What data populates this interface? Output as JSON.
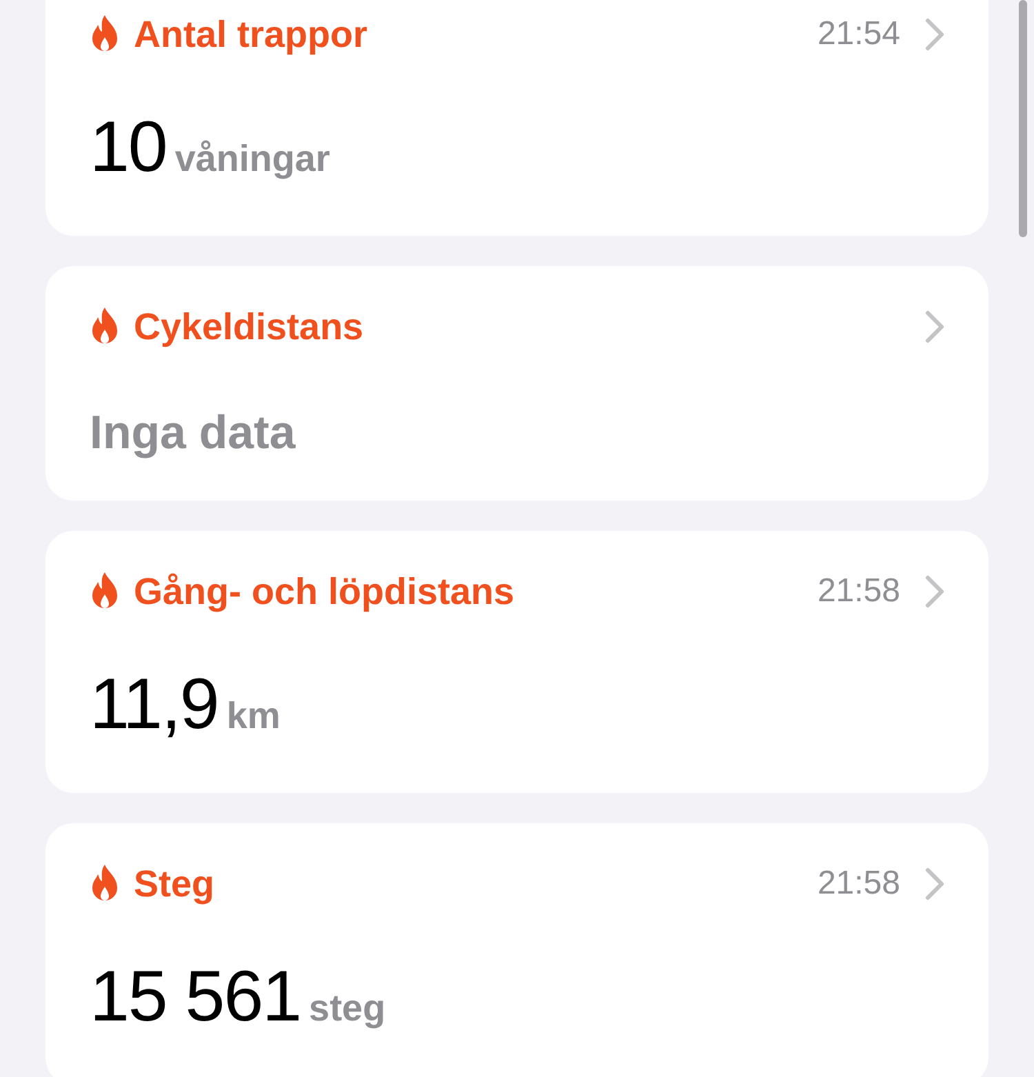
{
  "cards": [
    {
      "kind": "value",
      "title": "Antal trappor",
      "time": "21:54",
      "value": "10",
      "unit": "våningar"
    },
    {
      "kind": "empty",
      "title": "Cykeldistans",
      "value": "Inga data"
    },
    {
      "kind": "value",
      "title": "Gång- och löpdistans",
      "time": "21:58",
      "value": "11,9",
      "unit": "km"
    },
    {
      "kind": "value",
      "title": "Steg",
      "time": "21:58",
      "value": "15 561",
      "unit": "steg"
    }
  ]
}
